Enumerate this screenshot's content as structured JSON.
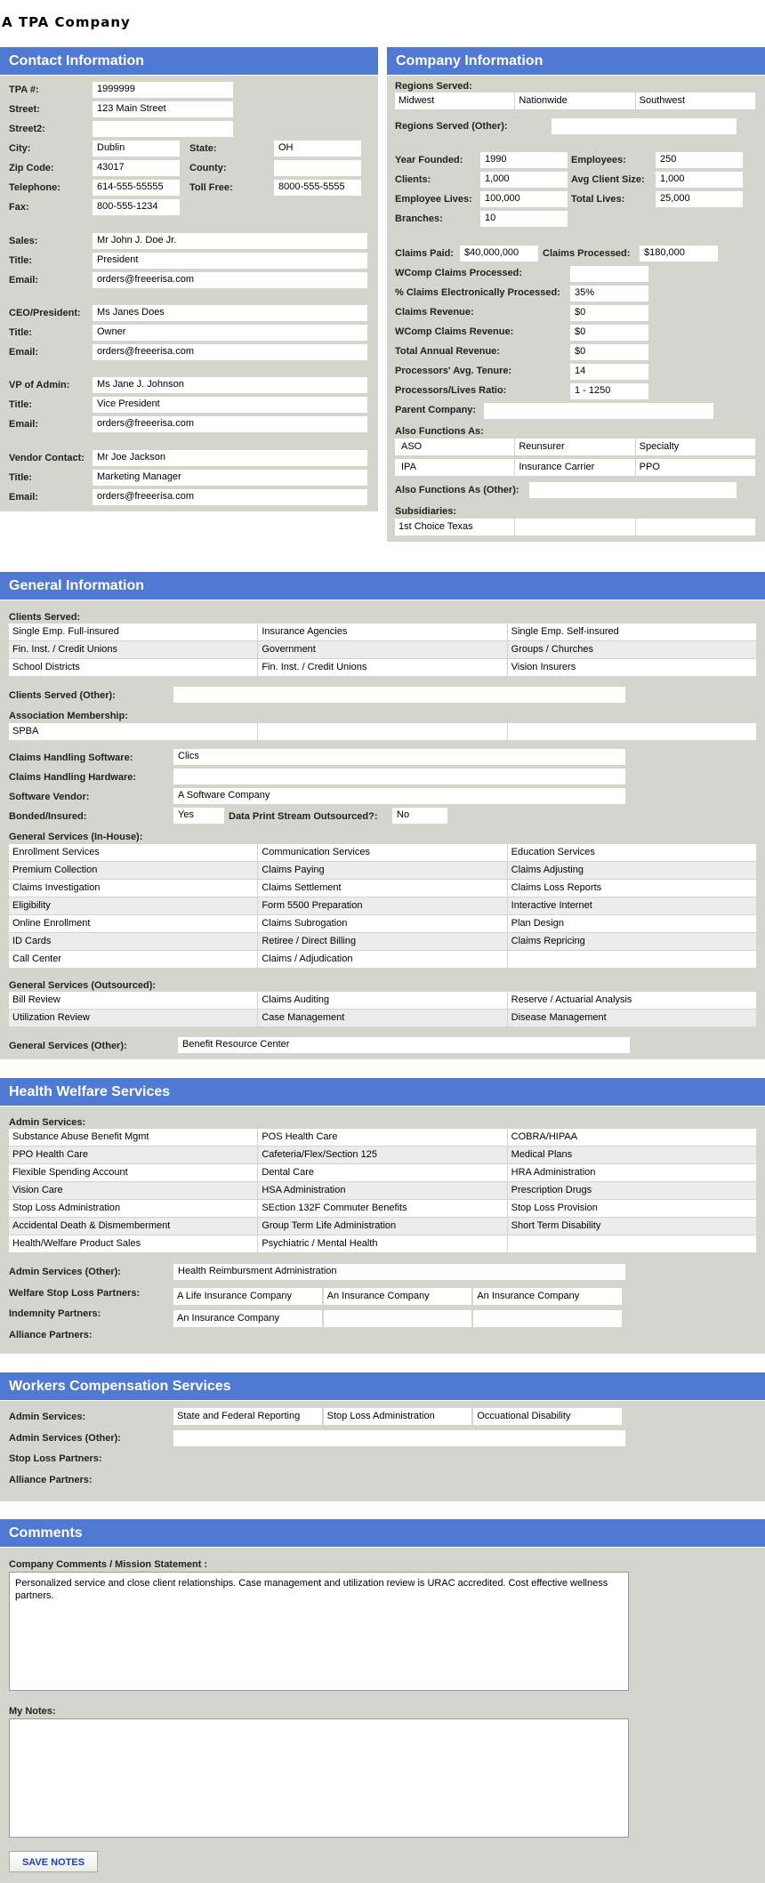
{
  "page_title": "A TPA Company",
  "contact": {
    "header": "Contact Information",
    "tpa_label": "TPA #:",
    "tpa": "1999999",
    "street_label": "Street:",
    "street": "123 Main Street",
    "street2_label": "Street2:",
    "street2": "",
    "city_label": "City:",
    "city": "Dublin",
    "state_label": "State:",
    "state": "OH",
    "zip_label": "Zip Code:",
    "zip": "43017",
    "county_label": "County:",
    "county": "",
    "telephone_label": "Telephone:",
    "telephone": "614-555-55555",
    "tollfree_label": "Toll Free:",
    "tollfree": "8000-555-5555",
    "fax_label": "Fax:",
    "fax": "800-555-1234",
    "contacts": [
      {
        "role_label": "Sales:",
        "name": "Mr John J. Doe Jr.",
        "title_label": "Title:",
        "title": "President",
        "email_label": "Email:",
        "email": "orders@freeerisa.com"
      },
      {
        "role_label": "CEO/President:",
        "name": "Ms Janes Does",
        "title_label": "Title:",
        "title": "Owner",
        "email_label": "Email:",
        "email": "orders@freeerisa.com"
      },
      {
        "role_label": "VP of Admin:",
        "name": "Ms Jane J. Johnson",
        "title_label": "Title:",
        "title": "Vice President",
        "email_label": "Email:",
        "email": "orders@freeerisa.com"
      },
      {
        "role_label": "Vendor Contact:",
        "name": "Mr Joe Jackson",
        "title_label": "Title:",
        "title": "Marketing Manager",
        "email_label": "Email:",
        "email": "orders@freeerisa.com"
      }
    ]
  },
  "company": {
    "header": "Company Information",
    "regions_label": "Regions Served:",
    "regions": [
      "Midwest",
      "Nationwide",
      "Southwest"
    ],
    "regions_other_label": "Regions Served (Other):",
    "regions_other": "",
    "year_founded_label": "Year Founded:",
    "year_founded": "1990",
    "employees_label": "Employees:",
    "employees": "250",
    "clients_label": "Clients:",
    "clients": "1,000",
    "avg_client_size_label": "Avg Client Size:",
    "avg_client_size": "1,000",
    "employee_lives_label": "Employee Lives:",
    "employee_lives": "100,000",
    "total_lives_label": "Total Lives:",
    "total_lives": "25,000",
    "branches_label": "Branches:",
    "branches": "10",
    "claims_paid_label": "Claims Paid:",
    "claims_paid": "$40,000,000",
    "claims_processed_label": "Claims Processed:",
    "claims_processed": "$180,000",
    "wcomp_claims_processed_label": "WComp Claims Processed:",
    "wcomp_claims_processed": "",
    "pct_electronic_label": "% Claims Electronically Processed:",
    "pct_electronic": "35%",
    "claims_revenue_label": "Claims Revenue:",
    "claims_revenue": "$0",
    "wcomp_claims_revenue_label": "WComp Claims Revenue:",
    "wcomp_claims_revenue": "$0",
    "total_annual_revenue_label": "Total Annual Revenue:",
    "total_annual_revenue": "$0",
    "processors_tenure_label": "Processors' Avg. Tenure:",
    "processors_tenure": "14",
    "processors_ratio_label": "Processors/Lives Ratio:",
    "processors_ratio": "1 - 1250",
    "parent_company_label": "Parent Company:",
    "parent_company": "",
    "also_functions_label": "Also Functions As:",
    "also_functions": [
      "ASO",
      "Reunsurer",
      "Specialty",
      "IPA",
      "Insurance Carrier",
      "PPO"
    ],
    "also_functions_other_label": "Also Functions As (Other):",
    "also_functions_other": "",
    "subsidiaries_label": "Subsidiaries:",
    "subsidiaries": [
      "1st Choice Texas",
      "",
      ""
    ]
  },
  "general": {
    "header": "General Information",
    "clients_served_label": "Clients Served:",
    "clients_served": [
      "Single Emp. Full-insured",
      "Insurance Agencies",
      "Single Emp. Self-insured",
      "Fin. Inst. / Credit Unions",
      "Government",
      "Groups / Churches",
      "School Districts",
      "Fin. Inst. / Credit Unions",
      "Vision Insurers"
    ],
    "clients_served_other_label": "Clients Served (Other):",
    "clients_served_other": "",
    "association_label": "Association Membership:",
    "association": [
      "SPBA",
      "",
      ""
    ],
    "software_label": "Claims Handling Software:",
    "software": "Clics",
    "hardware_label": "Claims Handling Hardware:",
    "hardware": "",
    "vendor_label": "Software Vendor:",
    "vendor": "A Software Company",
    "bonded_label": "Bonded/Insured:",
    "bonded": "Yes",
    "data_print_label": "Data Print Stream Outsourced?:",
    "data_print": "No",
    "inhouse_label": "General Services (In-House):",
    "inhouse": [
      "Enrollment Services",
      "Communication Services",
      "Education Services",
      "Premium Collection",
      "Claims Paying",
      "Claims Adjusting",
      "Claims Investigation",
      "Claims Settlement",
      "Claims Loss Reports",
      "Eligibility",
      "Form 5500 Preparation",
      "Interactive Internet",
      "Online Enrollment",
      "Claims Subrogation",
      "Plan Design",
      "ID Cards",
      "Retiree / Direct Billing",
      "Claims Repricing",
      "Call Center",
      "Claims / Adjudication",
      ""
    ],
    "outsourced_label": "General Services (Outsourced):",
    "outsourced": [
      "Bill Review",
      "Claims Auditing",
      "Reserve / Actuarial Analysis",
      "Utilization Review",
      "Case Management",
      "Disease Management"
    ],
    "other_label": "General Services (Other):",
    "other": "Benefit Resource Center"
  },
  "health": {
    "header": "Health Welfare Services",
    "admin_label": "Admin Services:",
    "admin": [
      "Substance Abuse Benefit Mgmt",
      "POS Health Care",
      "COBRA/HIPAA",
      "PPO Health Care",
      "Cafeteria/Flex/Section 125",
      "Medical Plans",
      "Flexible Spending Account",
      "Dental Care",
      "HRA Administration",
      "Vision Care",
      "HSA Administration",
      "Prescription Drugs",
      "Stop Loss Administration",
      "SEction 132F Commuter Benefits",
      "Stop Loss Provision",
      "Accidental Death & Dismemberment",
      "Group Term Life Administration",
      "Short Term Disability",
      "Health/Welfare Product Sales",
      "Psychiatric / Mental Health",
      ""
    ],
    "admin_other_label": "Admin Services (Other):",
    "admin_other": "Health Reimbursment Administration",
    "stop_loss_label": "Welfare Stop Loss Partners:",
    "stop_loss": [
      "A Life Insurance Company",
      "An Insurance Company",
      "An Insurance Company"
    ],
    "indemnity_label": "Indemnity Partners:",
    "indemnity": [
      "An Insurance Company",
      "",
      ""
    ],
    "alliance_label": "Alliance Partners:"
  },
  "workers": {
    "header": "Workers Compensation Services",
    "admin_label": "Admin Services:",
    "admin": [
      "State and Federal Reporting",
      "Stop Loss Administration",
      "Occuational Disability"
    ],
    "admin_other_label": "Admin Services (Other):",
    "admin_other": "",
    "stop_loss_label": "Stop Loss Partners:",
    "alliance_label": "Alliance Partners:"
  },
  "comments": {
    "header": "Comments",
    "mission_label": "Company Comments / Mission Statement :",
    "mission": "Personalized service and close client relationships. Case management and utilization review is URAC accredited. Cost effective wellness partners.",
    "notes_label": "My Notes:",
    "notes": "",
    "save_label": "SAVE NOTES"
  }
}
